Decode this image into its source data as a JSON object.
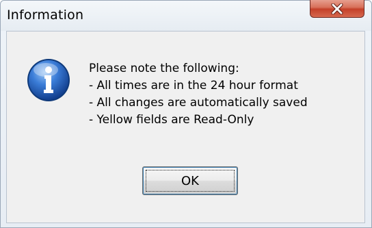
{
  "window": {
    "title": "Information",
    "close_icon": "close-icon"
  },
  "icon": {
    "name": "info-icon",
    "color": "#1f5fbf"
  },
  "message": {
    "lines": [
      "Please note the following:",
      "- All times are in the 24 hour format",
      "- All changes are automatically saved",
      "- Yellow fields are Read-Only"
    ]
  },
  "buttons": {
    "ok_label": "OK"
  }
}
